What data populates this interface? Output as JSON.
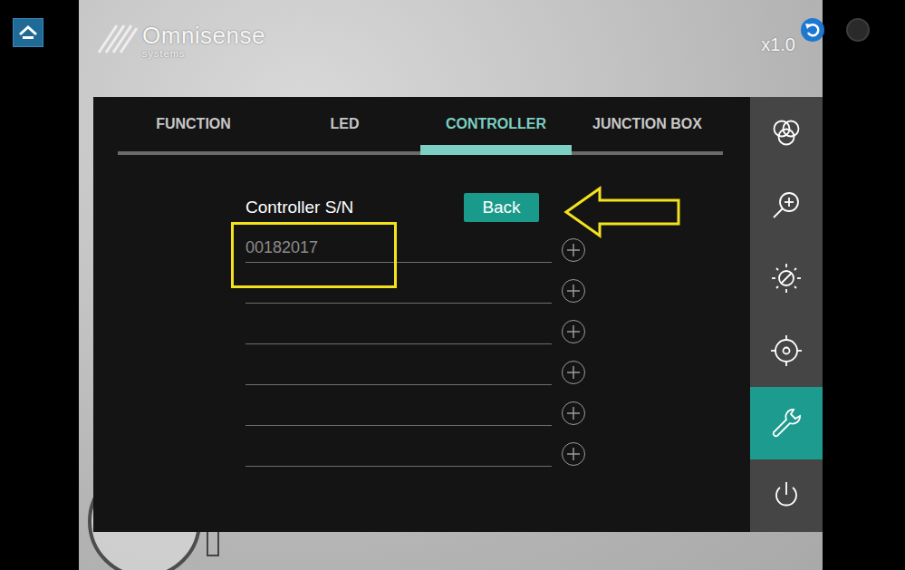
{
  "header": {
    "logo": "Omnisense",
    "logo_sub": "systems",
    "zoom": "x1.0"
  },
  "tabs": [
    {
      "label": "FUNCTION",
      "selected": false
    },
    {
      "label": "LED",
      "selected": false
    },
    {
      "label": "CONTROLLER",
      "selected": true
    },
    {
      "label": "JUNCTION BOX",
      "selected": false
    }
  ],
  "sidebar": {
    "items": [
      {
        "kind": "color",
        "selected": false
      },
      {
        "kind": "zoom",
        "selected": false
      },
      {
        "kind": "brightness",
        "selected": false
      },
      {
        "kind": "target",
        "selected": false
      },
      {
        "kind": "settings",
        "selected": true
      },
      {
        "kind": "power",
        "selected": false
      }
    ]
  },
  "controller": {
    "label": "Controller S/N",
    "back": "Back",
    "fields": [
      {
        "value": "00182017"
      },
      {
        "value": ""
      },
      {
        "value": ""
      },
      {
        "value": ""
      },
      {
        "value": ""
      },
      {
        "value": ""
      }
    ]
  }
}
